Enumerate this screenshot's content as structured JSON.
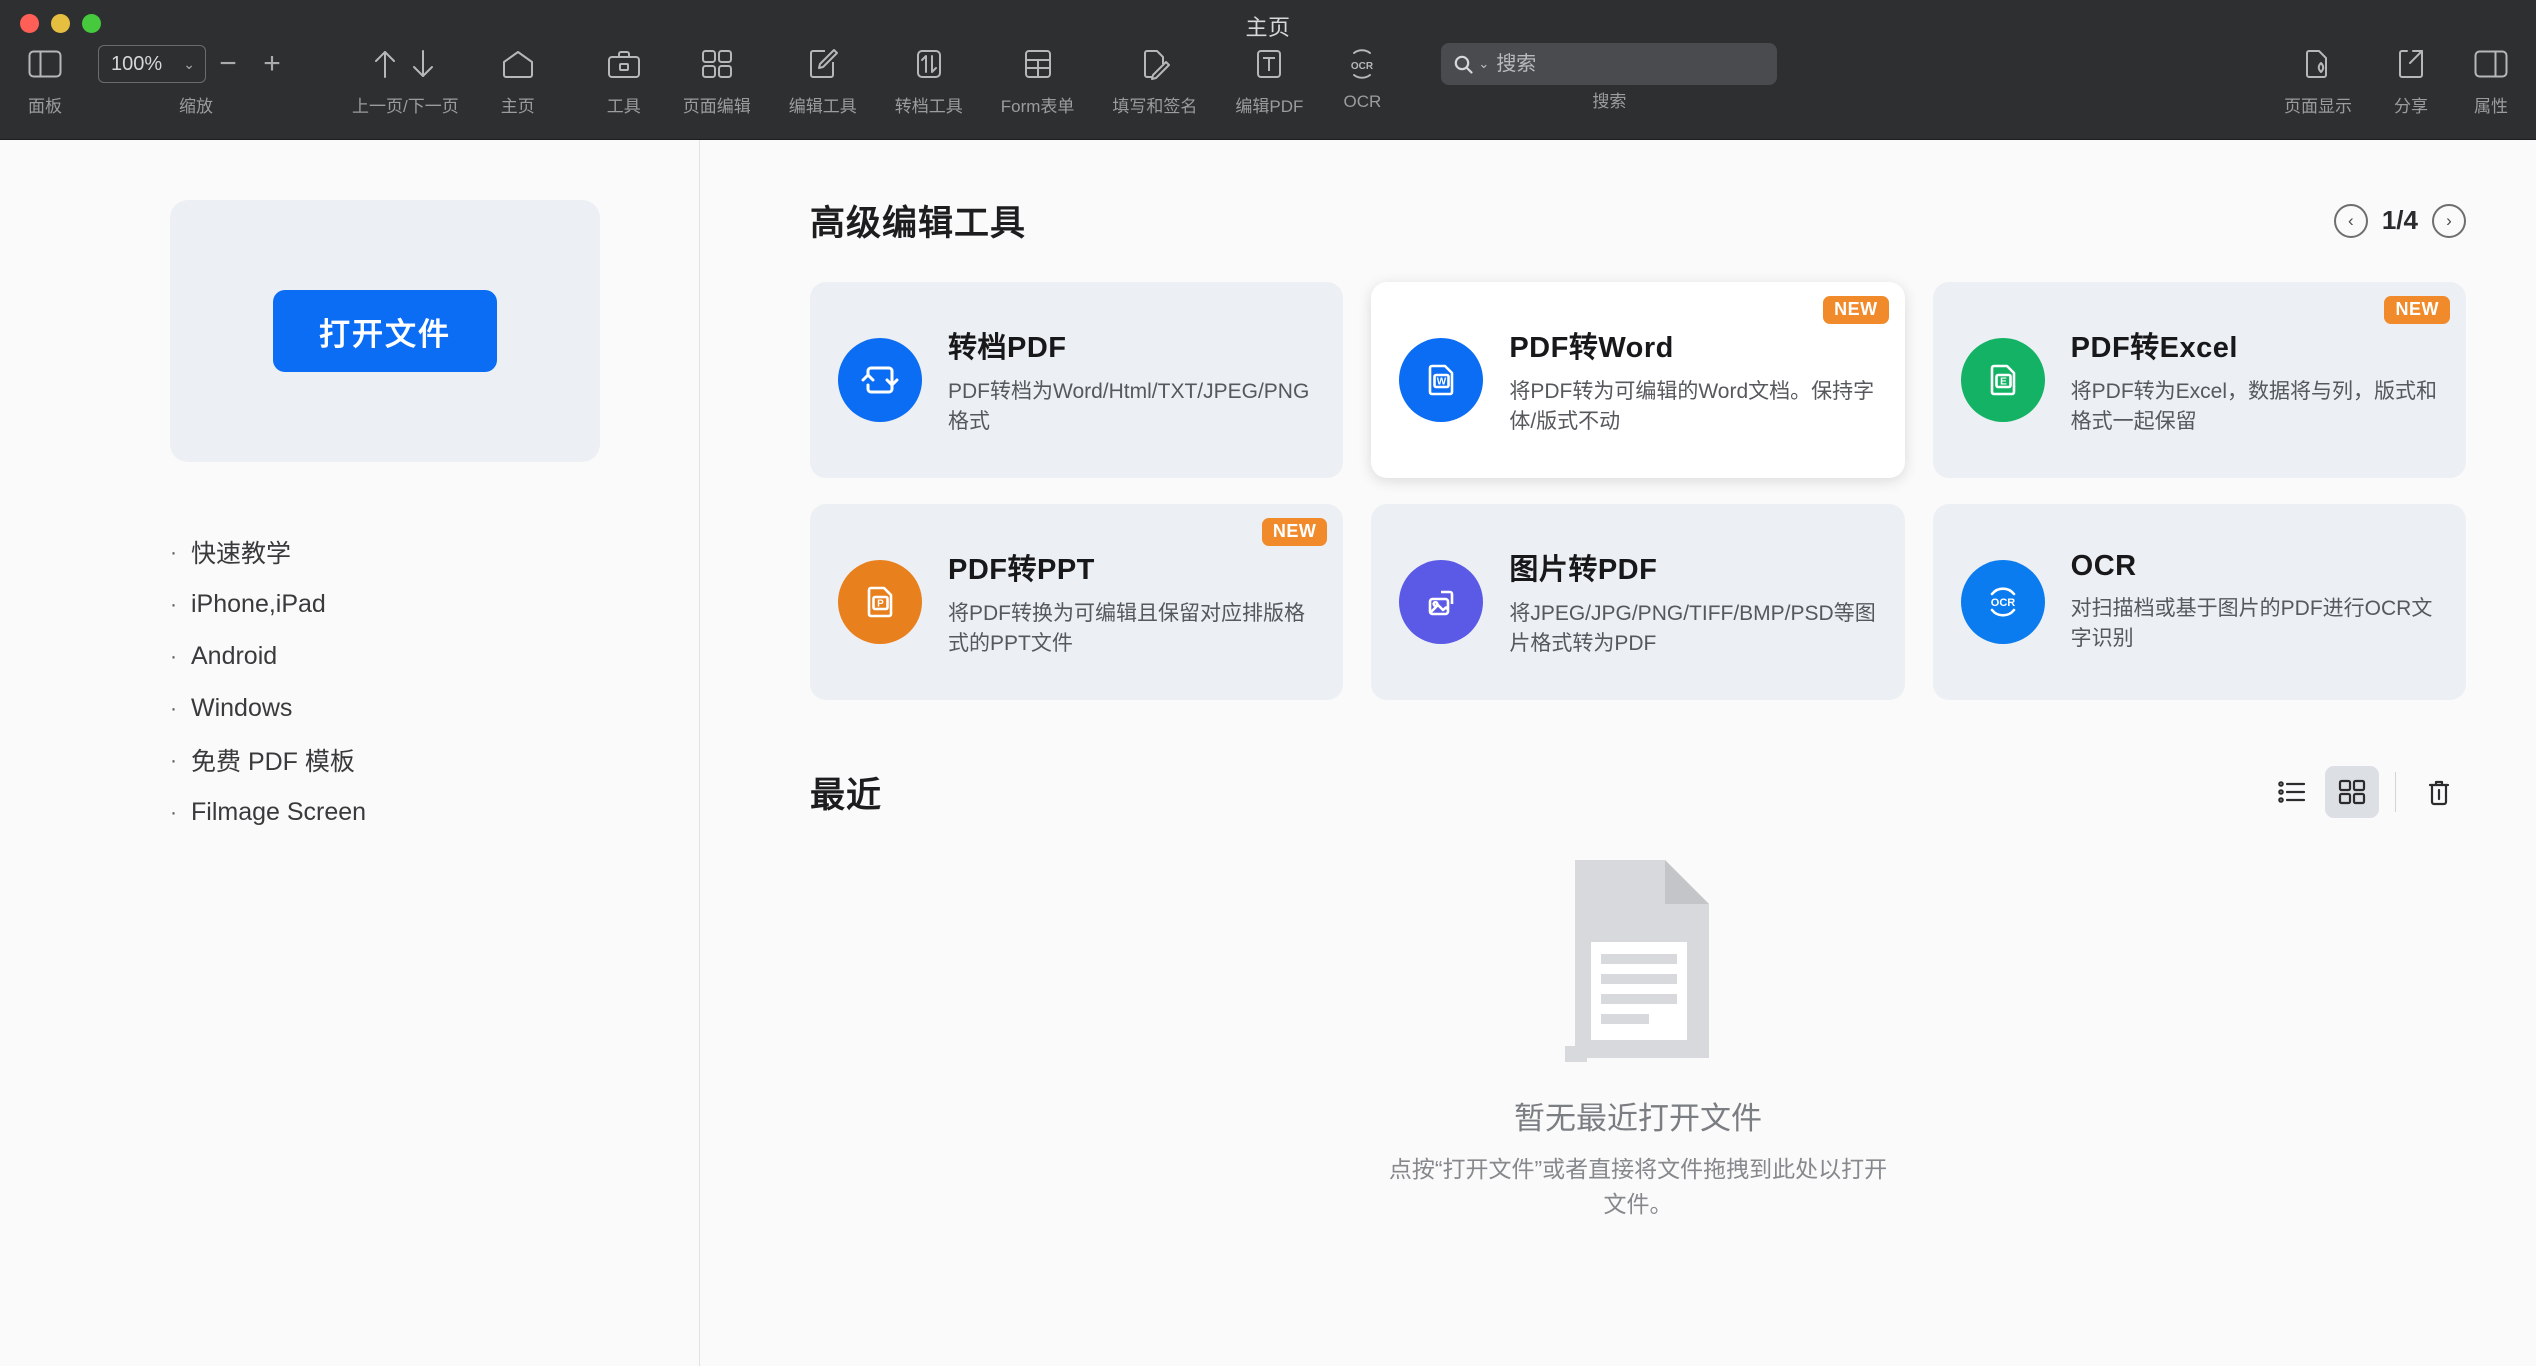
{
  "window": {
    "title": "主页",
    "traffic_lights": [
      "close",
      "minimize",
      "zoom"
    ]
  },
  "toolbar": {
    "panel": {
      "label": "面板",
      "icon": "sidebar-panel-icon"
    },
    "zoom": {
      "label": "缩放",
      "value": "100%",
      "minus": "−",
      "plus": "+",
      "chevron": "⌄"
    },
    "items": [
      {
        "label": "上一页/下一页",
        "icon": "prev-next-page-icon"
      },
      {
        "label": "主页",
        "icon": "home-icon"
      },
      {
        "label": "工具",
        "icon": "toolbox-icon"
      },
      {
        "label": "页面编辑",
        "icon": "page-edit-grid-icon"
      },
      {
        "label": "编辑工具",
        "icon": "edit-tools-pencil-icon"
      },
      {
        "label": "转档工具",
        "icon": "convert-tools-icon"
      },
      {
        "label": "Form表单",
        "icon": "form-table-icon"
      },
      {
        "label": "填写和签名",
        "icon": "fill-and-sign-icon"
      },
      {
        "label": "编辑PDF",
        "icon": "edit-pdf-text-icon"
      },
      {
        "label": "OCR",
        "icon": "ocr-icon"
      }
    ],
    "search": {
      "label": "搜索",
      "placeholder": "搜索",
      "value": "",
      "icon": "search-icon"
    },
    "right_items": [
      {
        "label": "页面显示",
        "icon": "page-display-icon"
      },
      {
        "label": "分享",
        "icon": "share-icon"
      },
      {
        "label": "属性",
        "icon": "properties-panel-icon"
      }
    ]
  },
  "sidebar": {
    "open_button": "打开文件",
    "items": [
      {
        "label": "快速教学"
      },
      {
        "label": "iPhone,iPad"
      },
      {
        "label": "Android"
      },
      {
        "label": "Windows"
      },
      {
        "label": "免费 PDF 模板"
      },
      {
        "label": "Filmage Screen"
      }
    ],
    "bullet": "·"
  },
  "main": {
    "section_title": "高级编辑工具",
    "pager": {
      "page": "1/4",
      "prev": "‹",
      "next": "›"
    },
    "cards": [
      {
        "title": "转档PDF",
        "desc": "PDF转档为Word/Html/TXT/JPEG/PNG格式",
        "badge": "",
        "icon": "convert-pdf-icon",
        "color": "#0b6cf4",
        "selected": false
      },
      {
        "title": "PDF转Word",
        "desc": "将PDF转为可编辑的Word文档。保持字体/版式不动",
        "badge": "NEW",
        "icon": "word-doc-icon",
        "color": "#0b6cf4",
        "selected": true
      },
      {
        "title": "PDF转Excel",
        "desc": "将PDF转为Excel，数据将与列，版式和格式一起保留",
        "badge": "NEW",
        "icon": "excel-doc-icon",
        "color": "#14b264",
        "selected": false
      },
      {
        "title": "PDF转PPT",
        "desc": "将PDF转换为可编辑且保留对应排版格式的PPT文件",
        "badge": "NEW",
        "icon": "ppt-doc-icon",
        "color": "#e8801e",
        "selected": false
      },
      {
        "title": "图片转PDF",
        "desc": "将JPEG/JPG/PNG/TIFF/BMP/PSD等图片格式转为PDF",
        "badge": "",
        "icon": "image-to-pdf-icon",
        "color": "#5a5ae6",
        "selected": false
      },
      {
        "title": "OCR",
        "desc": "对扫描档或基于图片的PDF进行OCR文字识别",
        "badge": "",
        "icon": "ocr-circle-icon",
        "color": "#0b7bf0",
        "selected": false
      }
    ],
    "recent": {
      "title": "最近",
      "view_list_icon": "list-view-icon",
      "view_grid_icon": "grid-view-icon",
      "delete_icon": "trash-icon",
      "empty_title": "暂无最近打开文件",
      "empty_sub": "点按“打开文件”或者直接将文件拖拽到此处以打开文件。",
      "empty_icon": "document-placeholder-icon"
    }
  },
  "colors": {
    "accent": "#0b6cf4",
    "badge": "#f08a2a",
    "toolbar_bg": "#2e2f31",
    "card_bg": "#eceff3"
  }
}
